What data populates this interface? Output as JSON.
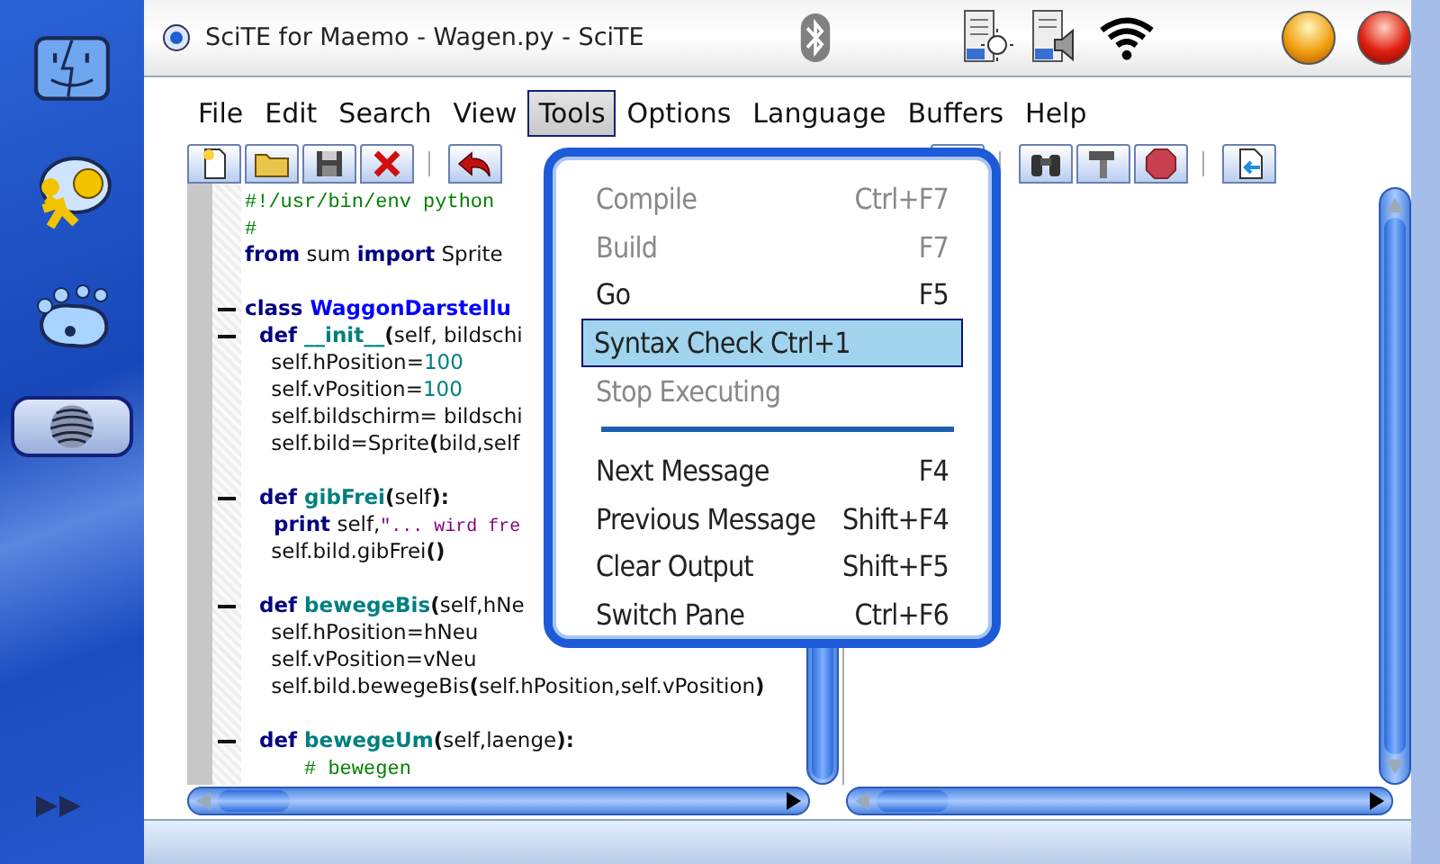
{
  "window": {
    "title": "SciTE for Maemo - Wagen.py - SciTE"
  },
  "menubar": {
    "items": [
      {
        "label": "File",
        "selected": false
      },
      {
        "label": "Edit",
        "selected": false
      },
      {
        "label": "Search",
        "selected": false
      },
      {
        "label": "View",
        "selected": false
      },
      {
        "label": "Tools",
        "selected": true
      },
      {
        "label": "Options",
        "selected": false
      },
      {
        "label": "Language",
        "selected": false
      },
      {
        "label": "Buffers",
        "selected": false
      },
      {
        "label": "Help",
        "selected": false
      }
    ]
  },
  "editor": {
    "lines": [
      {
        "fold": false,
        "parts": [
          {
            "kind": "comment",
            "text": "#!/usr/bin/env python"
          }
        ]
      },
      {
        "fold": false,
        "parts": [
          {
            "kind": "comment",
            "text": "#"
          }
        ]
      },
      {
        "fold": false,
        "parts": [
          {
            "kind": "keyword",
            "text": "from"
          },
          {
            "kind": "plain",
            "text": " sum "
          },
          {
            "kind": "keyword",
            "text": "import"
          },
          {
            "kind": "plain",
            "text": " Sprite"
          }
        ]
      },
      {
        "fold": false
      },
      {
        "fold": true,
        "parts": [
          {
            "kind": "keyword",
            "text": "class "
          },
          {
            "kind": "classname",
            "text": "WaggonDarstellu"
          }
        ]
      },
      {
        "fold": true,
        "parts": [
          {
            "kind": "keyword",
            "text": "  def "
          },
          {
            "kind": "defname",
            "text": "__init__"
          },
          {
            "kind": "operator",
            "text": "("
          },
          {
            "kind": "plain",
            "text": "self, bildschi"
          }
        ]
      },
      {
        "fold": false,
        "parts": [
          {
            "kind": "plain",
            "text": "    self.hPosition="
          },
          {
            "kind": "number",
            "text": "100"
          }
        ]
      },
      {
        "fold": false,
        "parts": [
          {
            "kind": "plain",
            "text": "    self.vPosition="
          },
          {
            "kind": "number",
            "text": "100"
          }
        ]
      },
      {
        "fold": false,
        "parts": [
          {
            "kind": "plain",
            "text": "    self.bildschirm= bildschi"
          }
        ]
      },
      {
        "fold": false,
        "parts": [
          {
            "kind": "plain",
            "text": "    self.bild=Sprite"
          },
          {
            "kind": "operator",
            "text": "("
          },
          {
            "kind": "plain",
            "text": "bild,self"
          }
        ]
      },
      {
        "fold": false
      },
      {
        "fold": true,
        "parts": [
          {
            "kind": "keyword",
            "text": "  def "
          },
          {
            "kind": "defname",
            "text": "gibFrei"
          },
          {
            "kind": "operator",
            "text": "("
          },
          {
            "kind": "plain",
            "text": "self"
          },
          {
            "kind": "operator",
            "text": "):"
          }
        ]
      },
      {
        "fold": false,
        "parts": [
          {
            "kind": "keyword",
            "text": "    print"
          },
          {
            "kind": "plain",
            "text": " self,"
          },
          {
            "kind": "string",
            "text": "\"... wird fre"
          }
        ]
      },
      {
        "fold": false,
        "parts": [
          {
            "kind": "plain",
            "text": "    self.bild.gibFrei"
          },
          {
            "kind": "operator",
            "text": "()"
          }
        ]
      },
      {
        "fold": false
      },
      {
        "fold": true,
        "parts": [
          {
            "kind": "keyword",
            "text": "  def "
          },
          {
            "kind": "defname",
            "text": "bewegeBis"
          },
          {
            "kind": "operator",
            "text": "("
          },
          {
            "kind": "plain",
            "text": "self,hNe"
          }
        ]
      },
      {
        "fold": false,
        "parts": [
          {
            "kind": "plain",
            "text": "    self.hPosition=hNeu"
          }
        ]
      },
      {
        "fold": false,
        "parts": [
          {
            "kind": "plain",
            "text": "    self.vPosition=vNeu"
          }
        ]
      },
      {
        "fold": false,
        "parts": [
          {
            "kind": "plain",
            "text": "    self.bild.bewegeBis"
          },
          {
            "kind": "operator",
            "text": "("
          },
          {
            "kind": "plain",
            "text": "self.hPosition,self.vPosition"
          },
          {
            "kind": "operator",
            "text": ")"
          }
        ]
      },
      {
        "fold": false
      },
      {
        "fold": true,
        "parts": [
          {
            "kind": "keyword",
            "text": "  def "
          },
          {
            "kind": "defname",
            "text": "bewegeUm"
          },
          {
            "kind": "operator",
            "text": "("
          },
          {
            "kind": "plain",
            "text": "self,laenge"
          },
          {
            "kind": "operator",
            "text": "):"
          }
        ]
      },
      {
        "fold": false,
        "parts": [
          {
            "kind": "comment",
            "text": "     # bewegen"
          }
        ]
      }
    ]
  },
  "tools_menu": {
    "items": [
      {
        "kind": "item",
        "label": "Compile",
        "shortcut": "Ctrl+F7",
        "disabled": true,
        "selected": false
      },
      {
        "kind": "item",
        "label": "Build",
        "shortcut": "F7",
        "disabled": true,
        "selected": false
      },
      {
        "kind": "item",
        "label": "Go",
        "shortcut": "F5",
        "disabled": false,
        "selected": false
      },
      {
        "kind": "item",
        "label": "Syntax Check Ctrl+1",
        "disabled": false,
        "selected": true
      },
      {
        "kind": "item",
        "label": "Stop Executing",
        "disabled": true,
        "selected": false
      },
      {
        "kind": "separator"
      },
      {
        "kind": "item",
        "label": "Next Message",
        "shortcut": "F4",
        "disabled": false,
        "selected": false
      },
      {
        "kind": "item",
        "label": "Previous Message",
        "shortcut": "Shift+F4",
        "disabled": false,
        "selected": false
      },
      {
        "kind": "item",
        "label": "Clear Output",
        "shortcut": "Shift+F5",
        "disabled": false,
        "selected": false
      },
      {
        "kind": "item",
        "label": "Switch Pane",
        "shortcut": "Ctrl+F6",
        "disabled": false,
        "selected": false
      }
    ]
  }
}
